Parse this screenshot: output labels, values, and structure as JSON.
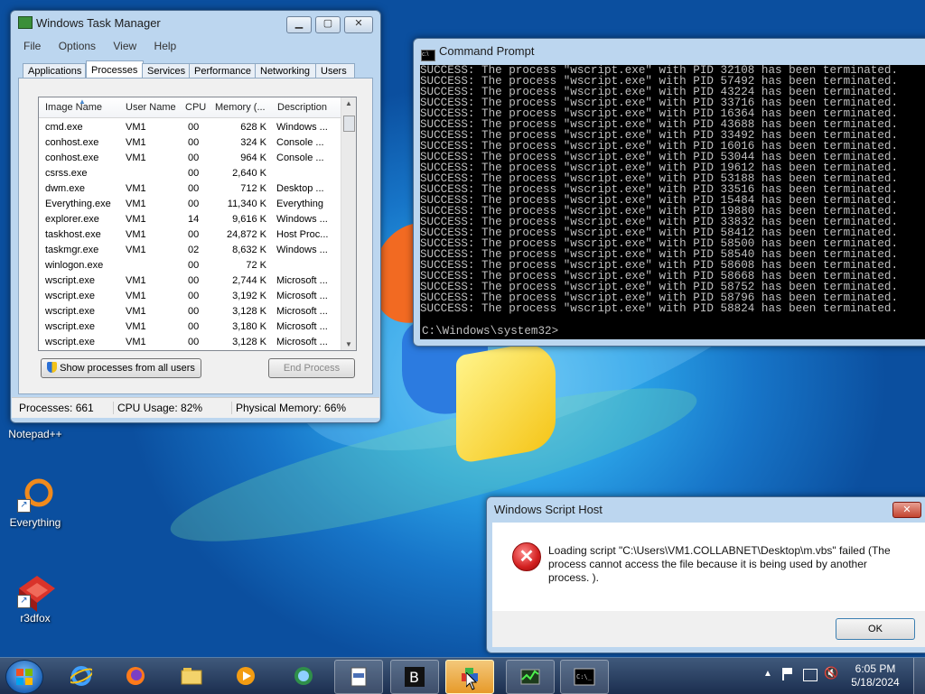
{
  "task_manager": {
    "title": "Windows Task Manager",
    "menu": [
      "File",
      "Options",
      "View",
      "Help"
    ],
    "tabs": [
      "Applications",
      "Processes",
      "Services",
      "Performance",
      "Networking",
      "Users"
    ],
    "columns": [
      "Image Name",
      "User Name",
      "CPU",
      "Memory (...",
      "Description"
    ],
    "rows": [
      {
        "image": "cmd.exe",
        "user": "VM1",
        "cpu": "00",
        "mem": "628 K",
        "desc": "Windows ..."
      },
      {
        "image": "conhost.exe",
        "user": "VM1",
        "cpu": "00",
        "mem": "324 K",
        "desc": "Console ..."
      },
      {
        "image": "conhost.exe",
        "user": "VM1",
        "cpu": "00",
        "mem": "964 K",
        "desc": "Console ..."
      },
      {
        "image": "csrss.exe",
        "user": "",
        "cpu": "00",
        "mem": "2,640 K",
        "desc": ""
      },
      {
        "image": "dwm.exe",
        "user": "VM1",
        "cpu": "00",
        "mem": "712 K",
        "desc": "Desktop ..."
      },
      {
        "image": "Everything.exe",
        "user": "VM1",
        "cpu": "00",
        "mem": "11,340 K",
        "desc": "Everything"
      },
      {
        "image": "explorer.exe",
        "user": "VM1",
        "cpu": "14",
        "mem": "9,616 K",
        "desc": "Windows ..."
      },
      {
        "image": "taskhost.exe",
        "user": "VM1",
        "cpu": "00",
        "mem": "24,872 K",
        "desc": "Host Proc..."
      },
      {
        "image": "taskmgr.exe",
        "user": "VM1",
        "cpu": "02",
        "mem": "8,632 K",
        "desc": "Windows ..."
      },
      {
        "image": "winlogon.exe",
        "user": "",
        "cpu": "00",
        "mem": "72 K",
        "desc": ""
      },
      {
        "image": "wscript.exe",
        "user": "VM1",
        "cpu": "00",
        "mem": "2,744 K",
        "desc": "Microsoft ..."
      },
      {
        "image": "wscript.exe",
        "user": "VM1",
        "cpu": "00",
        "mem": "3,192 K",
        "desc": "Microsoft ..."
      },
      {
        "image": "wscript.exe",
        "user": "VM1",
        "cpu": "00",
        "mem": "3,128 K",
        "desc": "Microsoft ..."
      },
      {
        "image": "wscript.exe",
        "user": "VM1",
        "cpu": "00",
        "mem": "3,180 K",
        "desc": "Microsoft ..."
      },
      {
        "image": "wscript.exe",
        "user": "VM1",
        "cpu": "00",
        "mem": "3,128 K",
        "desc": "Microsoft ..."
      }
    ],
    "show_all_label": "Show processes from all users",
    "end_process_label": "End Process",
    "status": {
      "processes": "Processes: 661",
      "cpu": "CPU Usage: 82%",
      "memory": "Physical Memory: 66%"
    }
  },
  "cmd": {
    "title": "Command Prompt",
    "pids": [
      "32108",
      "57492",
      "43224",
      "33716",
      "16364",
      "43688",
      "33492",
      "16016",
      "53044",
      "19612",
      "53188",
      "33516",
      "15484",
      "19880",
      "33832",
      "58412",
      "58500",
      "58540",
      "58608",
      "58668",
      "58752",
      "58796",
      "58824"
    ],
    "line_prefix": "SUCCESS: The process \"wscript.exe\" with PID ",
    "line_suffix": " has been terminated.",
    "prompt": "C:\\Windows\\system32>"
  },
  "script_host": {
    "title": "Windows Script Host",
    "message": "Loading script \"C:\\Users\\VM1.COLLABNET\\Desktop\\m.vbs\" failed (The process cannot access the file because it is being used by another process. ).",
    "ok_label": "OK"
  },
  "desktop_icons": [
    "Notepad++",
    "Everything",
    "r3dfox"
  ],
  "clock": {
    "time": "6:05 PM",
    "date": "5/18/2024"
  }
}
